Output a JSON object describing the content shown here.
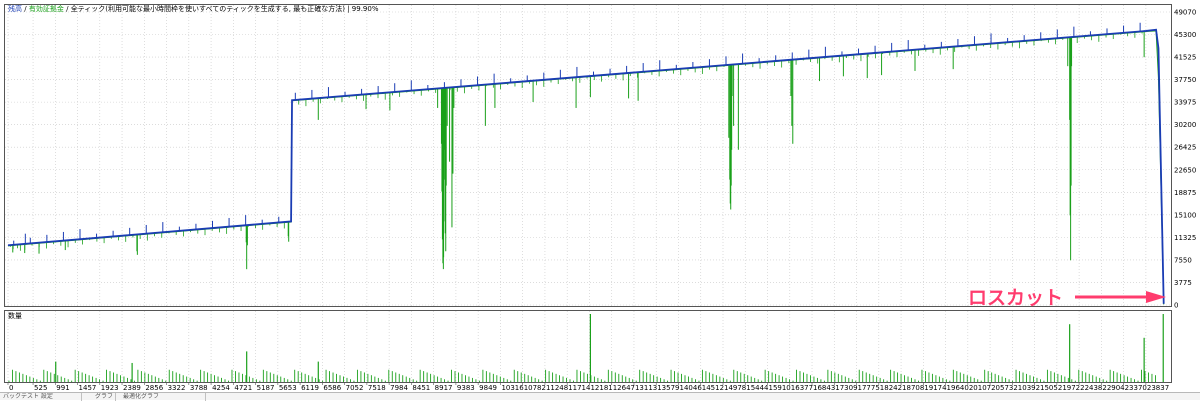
{
  "chart_data": [
    {
      "type": "line",
      "legend": {
        "items": [
          {
            "label": "残高",
            "color": "#1a3cb4"
          },
          {
            "label": "有効証拠金",
            "color": "#1aa01a"
          }
        ],
        "suffix": "全ティック(利用可能な最小時間枠を使いすべてのティックを生成する, 最も正確な方法)",
        "quality": "99.90%"
      },
      "y_ticks": [
        0,
        3775,
        7550,
        11325,
        15100,
        18875,
        22650,
        26425,
        30200,
        33975,
        37750,
        41525,
        45300,
        49070
      ],
      "ylim": [
        0,
        49070
      ],
      "xlim": [
        0,
        24300
      ],
      "series": [
        {
          "name": "残高",
          "color": "#1a3cb4",
          "points": [
            [
              0,
              10000
            ],
            [
              5930,
              14000
            ],
            [
              5950,
              34300
            ],
            [
              23840,
              45900
            ],
            [
              24050,
              46100
            ],
            [
              24100,
              43000
            ],
            [
              24210,
              200
            ]
          ]
        },
        {
          "name": "有効証拠金",
          "color": "#1aa01a",
          "points": [
            [
              0,
              9900
            ],
            [
              5930,
              13900
            ],
            [
              5950,
              34200
            ],
            [
              23840,
              45800
            ],
            [
              24050,
              45900
            ],
            [
              24100,
              38000
            ],
            [
              24150,
              21000
            ],
            [
              24210,
              100
            ]
          ],
          "drawdowns": [
            [
              100,
              8800
            ],
            [
              350,
              8700
            ],
            [
              650,
              8600
            ],
            [
              1200,
              9200
            ],
            [
              2700,
              9000
            ],
            [
              2710,
              8400
            ],
            [
              4990,
              10500
            ],
            [
              5000,
              6000
            ],
            [
              5015,
              10000
            ],
            [
              5870,
              11500
            ],
            [
              5880,
              10600
            ],
            [
              6500,
              31000
            ],
            [
              7500,
              32800
            ],
            [
              8000,
              32600
            ],
            [
              9000,
              33000
            ],
            [
              9080,
              27000
            ],
            [
              9090,
              19000
            ],
            [
              9100,
              11000
            ],
            [
              9110,
              7000
            ],
            [
              9120,
              6000
            ],
            [
              9125,
              8000
            ],
            [
              9130,
              14000
            ],
            [
              9140,
              21000
            ],
            [
              9150,
              26000
            ],
            [
              9160,
              12000
            ],
            [
              9170,
              9000
            ],
            [
              9180,
              20000
            ],
            [
              9200,
              30000
            ],
            [
              9250,
              24000
            ],
            [
              9300,
              13000
            ],
            [
              9320,
              22000
            ],
            [
              9340,
              33000
            ],
            [
              10000,
              30000
            ],
            [
              10200,
              33000
            ],
            [
              11000,
              34000
            ],
            [
              11900,
              33000
            ],
            [
              12200,
              34800
            ],
            [
              13000,
              34600
            ],
            [
              13200,
              34200
            ],
            [
              15100,
              28000
            ],
            [
              15120,
              21000
            ],
            [
              15130,
              17000
            ],
            [
              15140,
              16000
            ],
            [
              15150,
              20000
            ],
            [
              15160,
              26000
            ],
            [
              15170,
              35000
            ],
            [
              15200,
              30000
            ],
            [
              15300,
              26000
            ],
            [
              16400,
              35000
            ],
            [
              16420,
              30000
            ],
            [
              16440,
              27000
            ],
            [
              17000,
              37500
            ],
            [
              17500,
              38300
            ],
            [
              18000,
              38000
            ],
            [
              18300,
              38500
            ],
            [
              19000,
              39200
            ],
            [
              19800,
              39500
            ],
            [
              22200,
              40000
            ],
            [
              22240,
              31000
            ],
            [
              22250,
              15000
            ],
            [
              22260,
              7500
            ],
            [
              22270,
              20000
            ],
            [
              22280,
              40000
            ],
            [
              23800,
              41500
            ]
          ]
        }
      ]
    },
    {
      "type": "bar",
      "ylabel": "数量",
      "x_ticks": [
        0,
        525,
        991,
        1457,
        1923,
        2389,
        2856,
        3322,
        3788,
        4254,
        4721,
        5187,
        5653,
        6119,
        6586,
        7052,
        7518,
        7984,
        8451,
        8917,
        9383,
        9849,
        10316,
        10782,
        11248,
        11714,
        12181,
        12647,
        13113,
        13579,
        14046,
        14512,
        14978,
        15444,
        15910,
        16377,
        16843,
        17309,
        17775,
        18242,
        18708,
        19174,
        19640,
        20107,
        20573,
        21039,
        21505,
        21972,
        22438,
        22904,
        23370,
        23837
      ],
      "tall_bars": [
        [
          1000,
          0.3
        ],
        [
          2600,
          0.28
        ],
        [
          5000,
          0.45
        ],
        [
          6500,
          0.3
        ],
        [
          12200,
          1.0
        ],
        [
          22240,
          0.85
        ],
        [
          23800,
          0.65
        ],
        [
          24200,
          1.0
        ]
      ]
    }
  ],
  "annotation": {
    "text": "ロスカット"
  },
  "bottom_tabs": [
    "バックテスト 設定",
    "グラフ",
    "最適化グラフ"
  ]
}
